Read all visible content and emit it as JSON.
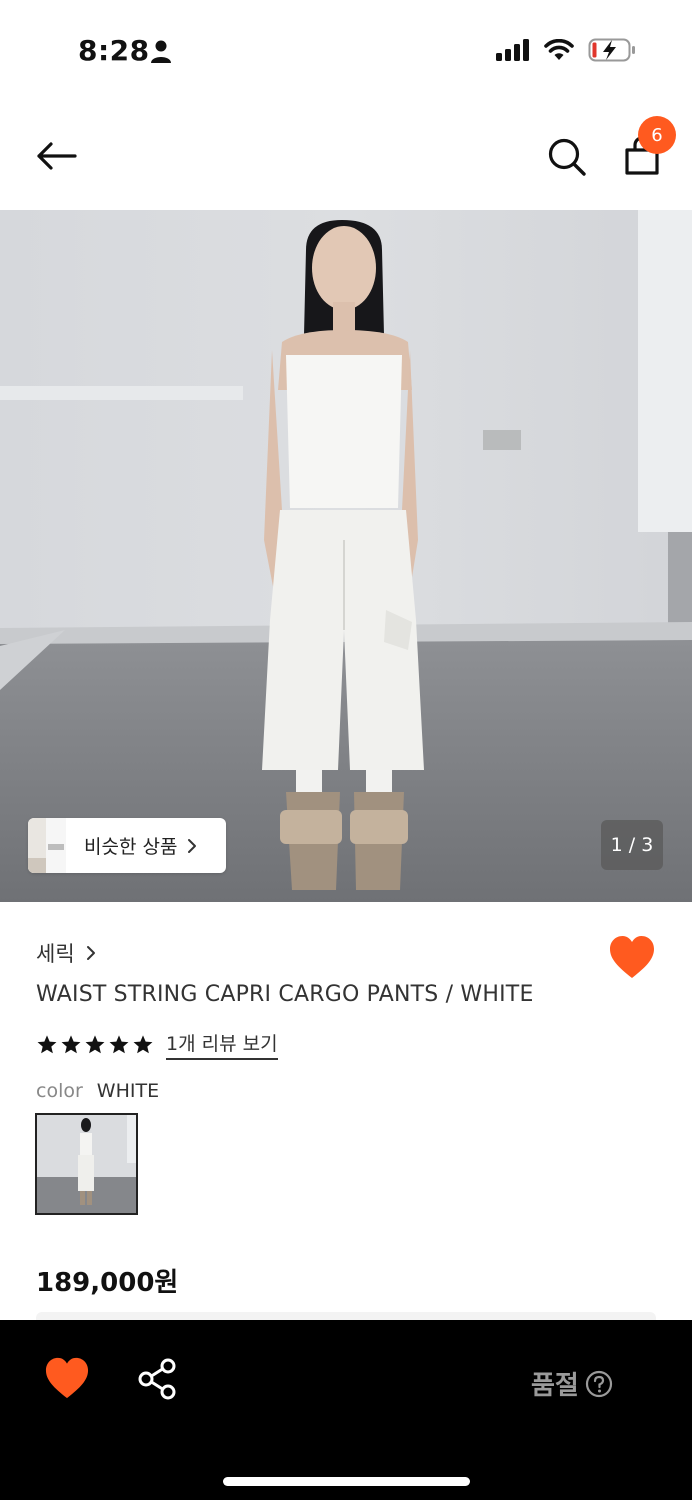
{
  "status": {
    "time": "8:28"
  },
  "header": {
    "cart_count": "6"
  },
  "gallery": {
    "similar_label": "비슷한 상품",
    "page_indicator": "1 / 3"
  },
  "product": {
    "brand": "세릭",
    "title": "WAIST STRING CAPRI CARGO PANTS / WHITE",
    "rating": 5,
    "review_link": "1개 리뷰 보기",
    "color_label": "color",
    "color_value": "WHITE",
    "price": "189,000원"
  },
  "bottom": {
    "status": "품절"
  },
  "colors": {
    "accent": "#FF5A1F",
    "bar": "#000000",
    "disabled_text": "#9A9A9A"
  }
}
